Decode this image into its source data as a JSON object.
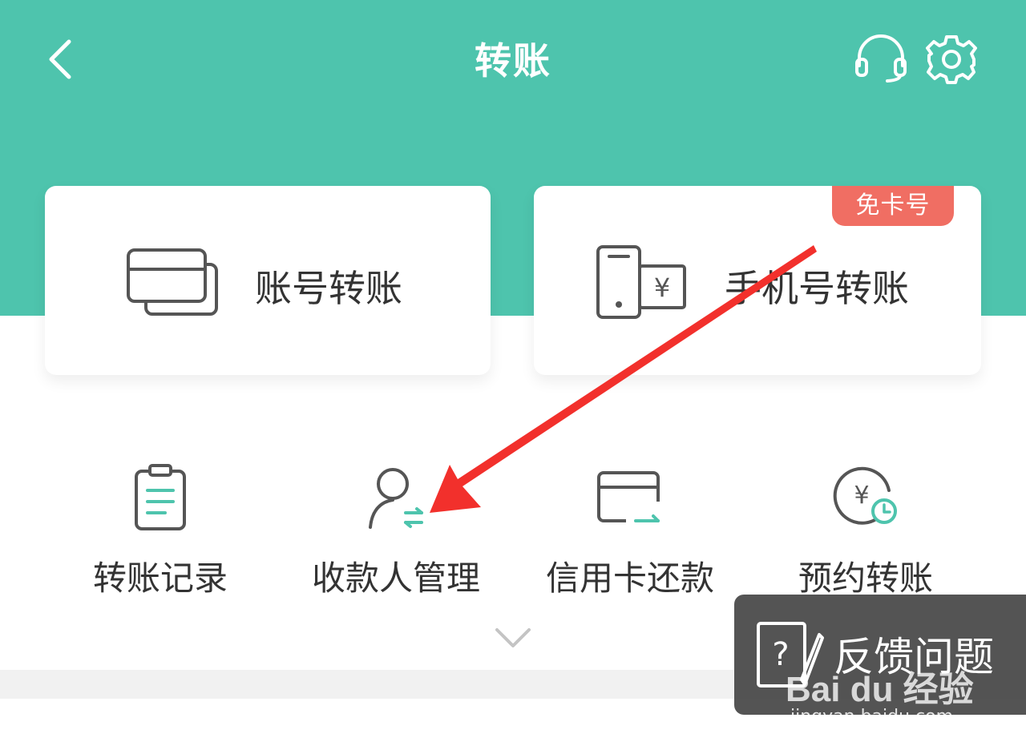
{
  "header": {
    "title": "转账",
    "background_color": "#4ec4ad",
    "back_icon": "chevron-left-icon",
    "service_icon": "headset-icon",
    "settings_icon": "gear-icon"
  },
  "cards": [
    {
      "label": "账号转账",
      "icon": "bank-cards-icon"
    },
    {
      "label": "手机号转账",
      "icon": "phone-yuan-icon",
      "badge": "免卡号",
      "badge_color": "#f06e63"
    }
  ],
  "quick_actions": [
    {
      "label": "转账记录",
      "icon": "clipboard-icon"
    },
    {
      "label": "收款人管理",
      "icon": "payee-manage-icon"
    },
    {
      "label": "信用卡还款",
      "icon": "credit-card-icon"
    },
    {
      "label": "预约转账",
      "icon": "yuan-clock-icon"
    }
  ],
  "expand_icon": "chevron-down-icon",
  "feedback": {
    "label": "反馈问题",
    "icon": "question-pencil-icon"
  },
  "watermark": {
    "logo": "Bai du 经验",
    "url": "jingyan.baidu.com"
  },
  "annotation": {
    "color": "#f2302c"
  }
}
